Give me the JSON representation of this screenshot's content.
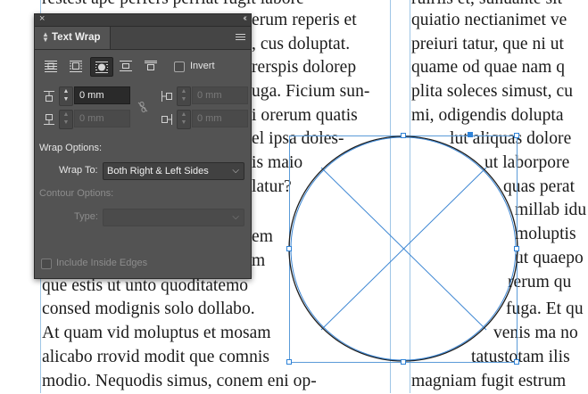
{
  "panel": {
    "title": "Text Wrap",
    "invert_label": "Invert",
    "top_offset": "0 mm",
    "bottom_offset": "0 mm",
    "left_offset": "0 mm",
    "right_offset": "0 mm",
    "wrap_options_label": "Wrap Options:",
    "wrap_to_label": "Wrap To:",
    "wrap_to_value": "Both Right & Left Sides",
    "contour_options_label": "Contour Options:",
    "type_label": "Type:",
    "type_value": "",
    "include_inside_edges_label": "Include Inside Edges",
    "selected_wrap_mode": "wrap-around-object-shape"
  },
  "document": {
    "left_column": [
      "restest ape perfers perriat fugit labore",
      "erum reperis et",
      ", cus doluptat.",
      "rerspis dolorep",
      "uga. Ficium sun-",
      "i orerum quatis",
      "el ipsa doles-",
      "is maio",
      "latur?",
      "em",
      "m",
      "que estis ut unto quoditatemo",
      "consed modignis solo dollabo.",
      "At quam vid moluptus et mosam",
      "alicabo rrovid modit que comnis",
      "modio. Nequodis simus, conem eni op-"
    ],
    "right_column_full": [
      "ruiriis et, sunuante sit",
      "quiatio nectianimet ve",
      "preiuri tatur, que ni ut",
      "quame od quae nam q",
      "plita soleces simust, cu",
      "mi, odigendis dolupta"
    ],
    "right_column_wrapped": [
      "lut aliquas dolore",
      "ut laborpore",
      "quas perat",
      "millab idu",
      "moluptis",
      "ut quaepo",
      "rerum qu",
      "fuga. Et qu",
      "venis ma no",
      "tatustotam ilis",
      "magniam fugit estrum"
    ]
  }
}
